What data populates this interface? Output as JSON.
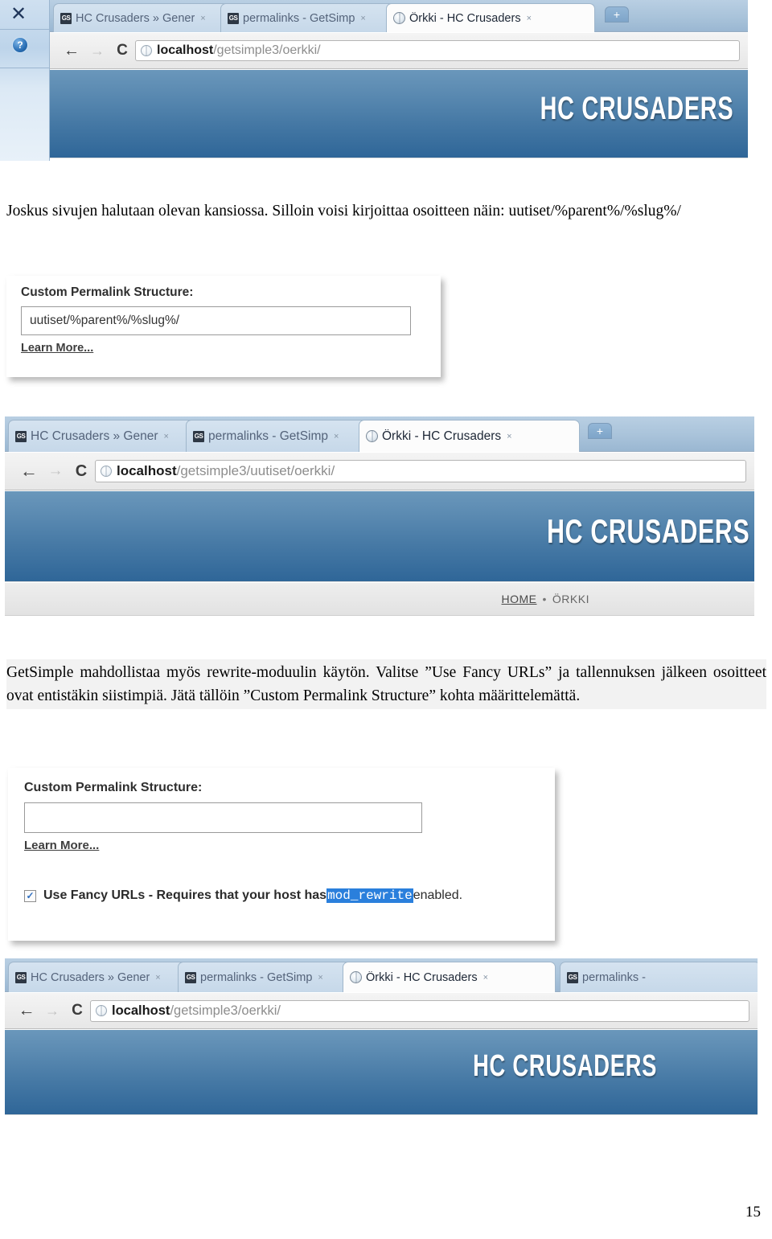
{
  "page": {
    "number": "15"
  },
  "paragraphs": {
    "p1": "Joskus sivujen halutaan olevan kansiossa. Silloin voisi kirjoittaa osoitteen näin: uutiset/%parent%/%slug%/",
    "p2": "GetSimple mahdollistaa myös rewrite-moduulin käytön. Valitse ”Use Fancy URLs” ja tallennuksen jälkeen osoitteet ovat entistäkin siistimpiä. Jätä tällöin ”Custom Permalink Structure” kohta määrittelemättä."
  },
  "browser1": {
    "window_close_label": "✕",
    "help_badge_label": "?",
    "tabs": [
      {
        "favicon": "GS",
        "label": "HC Crusaders » Gener",
        "close": "×",
        "active": false
      },
      {
        "favicon": "GS",
        "label": "permalinks - GetSimp",
        "close": "×",
        "active": false
      },
      {
        "favicon": "globe",
        "label": "Örkki - HC Crusaders",
        "close": "×",
        "active": true
      }
    ],
    "new_tab_label": "+",
    "toolbar": {
      "back": "←",
      "forward": "→",
      "reload": "C"
    },
    "url": {
      "host": "localhost",
      "path": "/getsimple3/oerkki/"
    },
    "site": {
      "logo": "HC CRUSADERS"
    }
  },
  "panel1": {
    "label": "Custom Permalink Structure:",
    "input_value": "uutiset/%parent%/%slug%/",
    "learn_more": "Learn More..."
  },
  "browser2": {
    "tabs": [
      {
        "favicon": "GS",
        "label": "HC Crusaders » Gener",
        "close": "×",
        "active": false
      },
      {
        "favicon": "GS",
        "label": "permalinks - GetSimp",
        "close": "×",
        "active": false
      },
      {
        "favicon": "globe",
        "label": "Örkki - HC Crusaders",
        "close": "×",
        "active": true
      }
    ],
    "new_tab_label": "+",
    "toolbar": {
      "back": "←",
      "forward": "→",
      "reload": "C"
    },
    "url": {
      "host": "localhost",
      "path": "/getsimple3/uutiset/oerkki/"
    },
    "site": {
      "logo": "HC CRUSADERS",
      "nav": {
        "home": "HOME",
        "separator": "•",
        "current": "ÖRKKI"
      }
    }
  },
  "panel2": {
    "label": "Custom Permalink Structure:",
    "input_value": "",
    "input_placeholder": "",
    "learn_more": "Learn More...",
    "checkbox": {
      "checked": true,
      "check_glyph": "✓",
      "text_before": "Use Fancy URLs - Requires that your host has ",
      "highlight": "mod_rewrite",
      "text_after": " enabled."
    }
  },
  "browser3": {
    "tabs": [
      {
        "favicon": "GS",
        "label": "HC Crusaders » Gener",
        "close": "×",
        "active": false
      },
      {
        "favicon": "GS",
        "label": "permalinks - GetSimp",
        "close": "×",
        "active": false
      },
      {
        "favicon": "globe",
        "label": "Örkki - HC Crusaders",
        "close": "×",
        "active": true
      },
      {
        "favicon": "GS",
        "label": "permalinks -",
        "close": "",
        "active": false
      }
    ],
    "toolbar": {
      "back": "←",
      "forward": "→",
      "reload": "C"
    },
    "url": {
      "host": "localhost",
      "path": "/getsimple3/oerkki/"
    },
    "site": {
      "logo": "HC CRUSADERS"
    }
  },
  "colors": {
    "header_top": "#6a97bb",
    "header_bottom": "#2f6698",
    "tabstrip": "#a9c3da",
    "highlight_blue": "#2a7fdc",
    "checkmark_blue": "#2f6fc0"
  }
}
